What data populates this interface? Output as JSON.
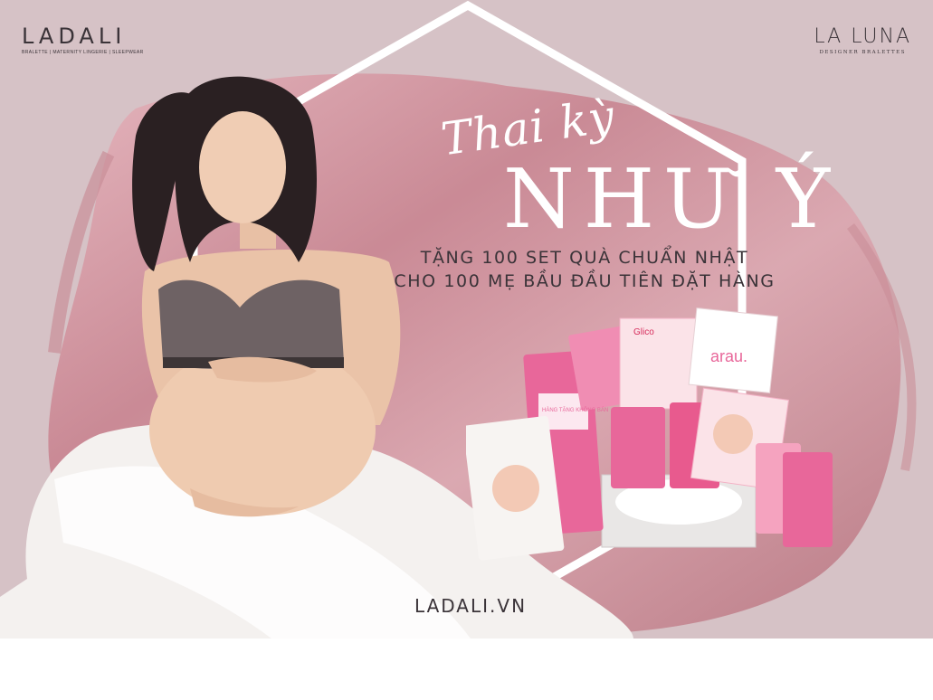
{
  "header": {
    "left_logo": {
      "brand": "LADALI",
      "tagline": "BRALETTE | MATERNITY LINGERIE | SLEEPWEAR"
    },
    "right_logo": {
      "brand": "LA LUNA",
      "tagline": "DESIGNER BRALETTES"
    }
  },
  "hero": {
    "script_title": "Thai kỳ",
    "big_title": "NHƯ Ý",
    "promo_line_1": "TẶNG 100 SET QUÀ CHUẨN NHẬT",
    "promo_line_2": "CHO 100 MẸ BẦU ĐẦU TIÊN ĐẶT HÀNG"
  },
  "products": {
    "label_arau": "arau.",
    "label_glico": "Glico",
    "label_gift": "HÀNG TẶNG KHÔNG BÁN"
  },
  "footer": {
    "website": "LADALI.VN"
  },
  "colors": {
    "background": "#d6c2c6",
    "brush": "#c98e98",
    "brush_light": "#e3b3bb",
    "text_dark": "#3a3338",
    "white": "#ffffff",
    "product_pink": "#e8679a"
  }
}
